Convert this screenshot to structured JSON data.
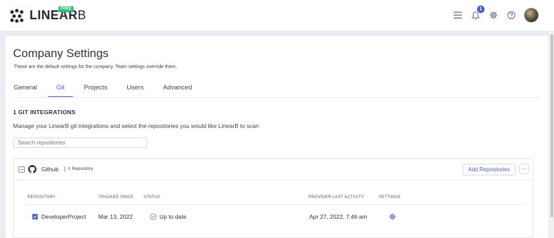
{
  "brand": {
    "name_bold": "LINEAR",
    "name_thin": "B",
    "badge": "FREE"
  },
  "topbar": {
    "notification_count": "1"
  },
  "page": {
    "title": "Company Settings",
    "subtitle": "These are the default settings for the company. Team settings override them."
  },
  "tabs": [
    {
      "label": "General",
      "active": false
    },
    {
      "label": "Git",
      "active": true
    },
    {
      "label": "Projects",
      "active": false
    },
    {
      "label": "Users",
      "active": false
    },
    {
      "label": "Advanced",
      "active": false
    }
  ],
  "git": {
    "heading": "1 GIT INTEGRATIONS",
    "description": "Manage your LinearB git integrations and select the repositories you would like LinearB to scan",
    "search_placeholder": "Search repositories",
    "integration": {
      "provider": "Github",
      "repo_count": "1 Repository",
      "add_button": "Add Repositories",
      "more_button": "···",
      "columns": {
        "repository": "REPOSITORY",
        "tracked_since": "TRACKED SINCE",
        "status": "STATUS",
        "provider_activity": "PROVIDER LAST ACTIVITY",
        "settings": "SETTINGS"
      },
      "rows": [
        {
          "selected": true,
          "repository": "DeveloperProject",
          "tracked_since": "Mar 13, 2022",
          "status": "Up to date",
          "provider_activity": "Apr 27, 2022, 7:46 am"
        }
      ]
    }
  },
  "colors": {
    "accent": "#4d5dd8",
    "badge": "#2fbf71",
    "background": "#e9ecf3"
  }
}
